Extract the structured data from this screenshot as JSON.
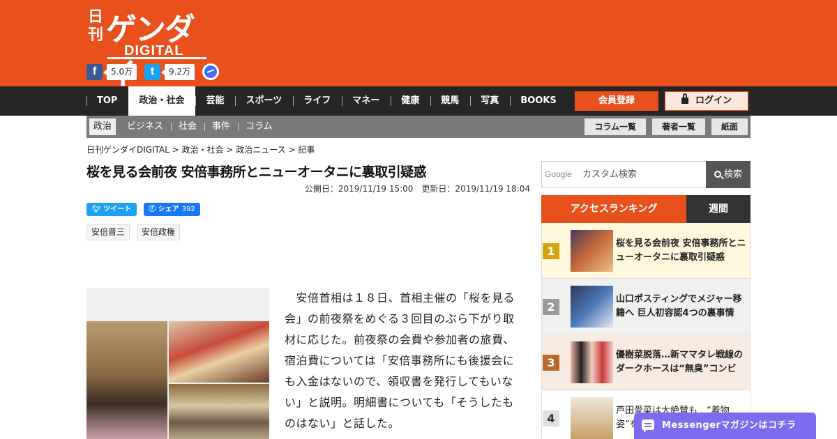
{
  "logo": {
    "nikkan": "日刊",
    "gendai": "ゲンダイ",
    "digital": "DIGITAL"
  },
  "social": {
    "facebook_count": "5.0万",
    "twitter_count": "9.2万"
  },
  "nav": {
    "items": [
      "TOP",
      "政治・社会",
      "芸能",
      "スポーツ",
      "ライフ",
      "マネー",
      "健康",
      "競馬",
      "写真",
      "BOOKS"
    ],
    "active": "政治・社会",
    "register_label": "会員登録",
    "login_label": "ログイン"
  },
  "subnav": {
    "items": [
      "政治",
      "ビジネス",
      "社会",
      "事件",
      "コラム"
    ],
    "buttons": [
      "コラム一覧",
      "著者一覧",
      "紙面"
    ]
  },
  "breadcrumb": "日刊ゲンダイDIGITAL > 政治・社会 > 政治ニュース > 記事",
  "article": {
    "title": "桜を見る会前夜 安倍事務所とニューオータニに裏取引疑惑",
    "dates": "公開日：2019/11/19 15:00　更新日：2019/11/19 18:04",
    "tweet_label": "ツイート",
    "share_label": "シェア",
    "share_count": "392",
    "tags": [
      "安倍晋三",
      "安倍政権"
    ],
    "body": "　安倍首相は１８日、首相主催の「桜を見る会」の前夜祭をめぐる３回目のぶら下がり取材に応じた。前夜祭の会費や参加者の旅費、宿泊費については「安倍事務所にも後援会にも入金はないので、領収書を発行してもいない」と説明。明細書についても「そうしたものはない」と話した。"
  },
  "search": {
    "google_label": "Google",
    "placeholder": "カスタム検索",
    "button_label": "検索"
  },
  "ranking": {
    "tab_access": "アクセスランキング",
    "tab_weekly": "週間",
    "items": [
      {
        "rank": "1",
        "title": "桜を見る会前夜 安倍事務所とニューオータニに裏取引疑惑"
      },
      {
        "rank": "2",
        "title": "山口ポスティングでメジャー移籍へ 巨人初容認4つの裏事情"
      },
      {
        "rank": "3",
        "title": "優樹菜脱落…新ママタレ戦線のダークホースは“無臭”コンビ"
      },
      {
        "rank": "4",
        "title": "芦田愛菜は大絶賛も　“着物姿”を比べ"
      }
    ]
  },
  "messenger_banner": "Messengerマガジンはコチラ"
}
